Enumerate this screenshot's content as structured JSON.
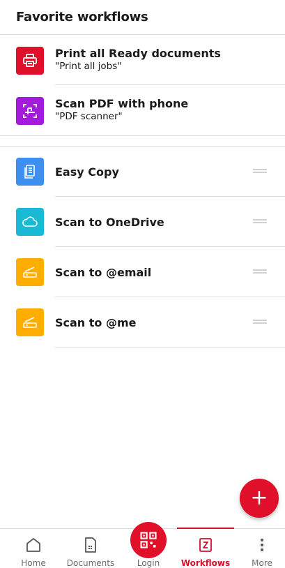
{
  "header": {
    "title": "Favorite workflows"
  },
  "favorites": [
    {
      "title": "Print all Ready documents",
      "subtitle": "\"Print all jobs\"",
      "icon": "printer-icon",
      "color": "#e0102b"
    },
    {
      "title": "Scan PDF with phone",
      "subtitle": "\"PDF scanner\"",
      "icon": "pdf-scan-icon",
      "color": "#a41adb"
    }
  ],
  "workflows": [
    {
      "title": "Easy Copy",
      "icon": "copy-document-icon",
      "color": "#3d8ff0"
    },
    {
      "title": "Scan to OneDrive",
      "icon": "cloud-icon",
      "color": "#1ab9d6"
    },
    {
      "title": "Scan to @email",
      "icon": "scanner-icon",
      "color": "#ffae00"
    },
    {
      "title": "Scan to @me",
      "icon": "scanner-icon",
      "color": "#ffae00"
    }
  ],
  "fab": {
    "label": "+"
  },
  "nav": {
    "home": "Home",
    "documents": "Documents",
    "login": "Login",
    "workflows": "Workflows",
    "more": "More"
  },
  "colors": {
    "accent": "#d0112b"
  }
}
